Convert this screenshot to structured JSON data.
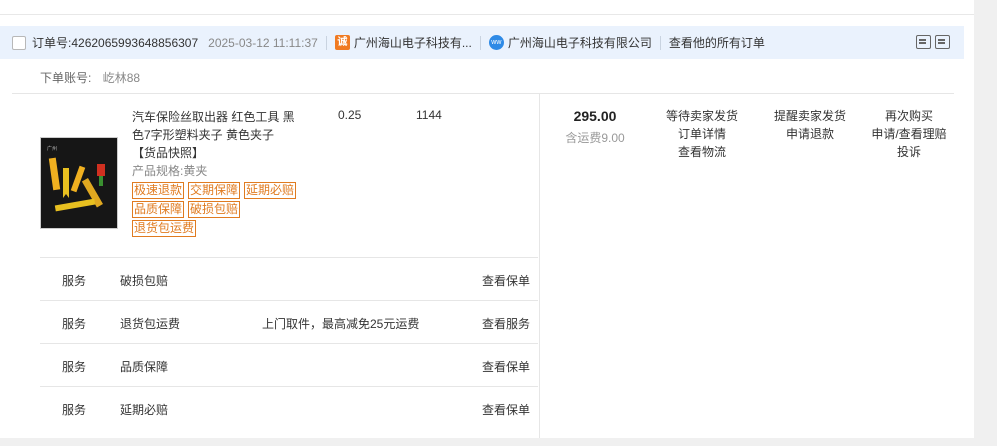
{
  "order": {
    "label": "订单号:",
    "number": "4262065993648856307",
    "time": "2025-03-12 11:11:37",
    "shop_short": "广州海山电子科技有...",
    "shop_full": "广州海山电子科技有限公司",
    "view_all": "查看他的所有订单"
  },
  "account": {
    "label": "下单账号:",
    "value": "屹林88"
  },
  "product": {
    "title": "汽车保险丝取出器 红色工具 黑色7字形塑料夹子 黄色夹子",
    "snapshot": "【货品快照】",
    "spec": "产品规格:黄夹",
    "tags": [
      "极速退款",
      "交期保障",
      "延期必赔",
      "品质保障",
      "破损包赔",
      "退货包运费"
    ],
    "unit_price": "0.25",
    "quantity": "1144"
  },
  "payment": {
    "total": "295.00",
    "shipping": "含运费9.00"
  },
  "status_actions": [
    "等待卖家发货",
    "订单详情",
    "查看物流"
  ],
  "seller_actions": [
    "提醒卖家发货",
    "申请退款"
  ],
  "more_actions": [
    "再次购买",
    "申请/查看理赔",
    "投诉"
  ],
  "services": [
    {
      "label": "服务",
      "name": "破损包赔",
      "desc": "",
      "action": "查看保单"
    },
    {
      "label": "服务",
      "name": "退货包运费",
      "desc": "上门取件，最高减免25元运费",
      "action": "查看服务"
    },
    {
      "label": "服务",
      "name": "品质保障",
      "desc": "",
      "action": "查看保单"
    },
    {
      "label": "服务",
      "name": "延期必赔",
      "desc": "",
      "action": "查看保单"
    }
  ],
  "colors": {
    "header_bg": "#eaf2fd",
    "tag_orange": "#e07b20",
    "shop_icon": "#f07a22",
    "wangwang_icon": "#2e8ae6"
  },
  "icons": {
    "shop": "shop-icon",
    "chat": "wangwang-icon",
    "tools": [
      "note-icon",
      "flag-icon"
    ]
  }
}
